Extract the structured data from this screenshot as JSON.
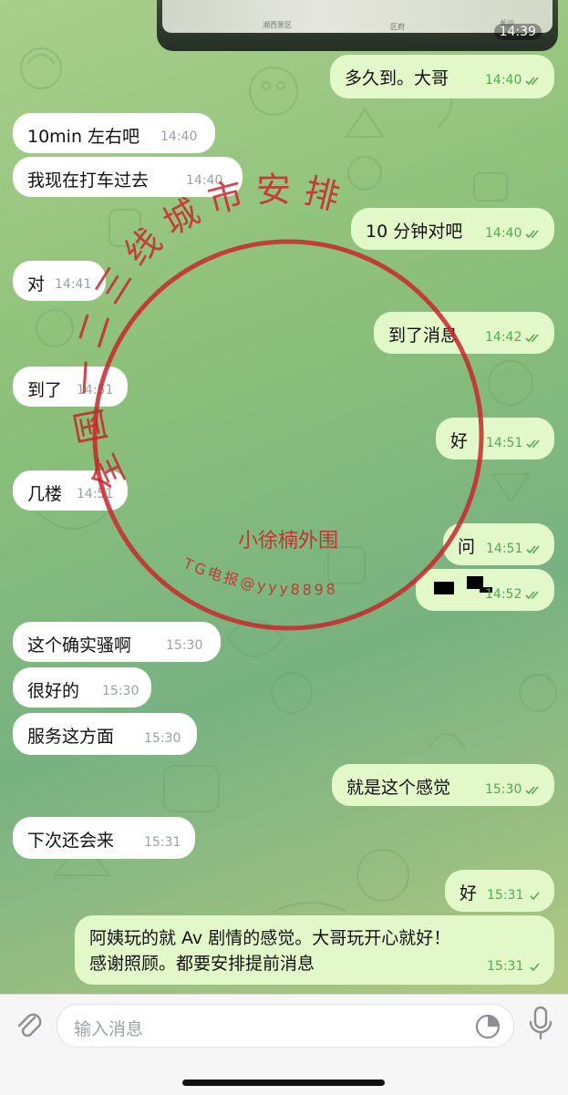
{
  "image_message": {
    "time": "14:39",
    "map_labels": [
      "湘西景区",
      "长沙",
      "区府"
    ]
  },
  "messages": [
    {
      "id": "m1",
      "dir": "out",
      "text": "多久到。大哥",
      "time": "14:40",
      "read": true
    },
    {
      "id": "m2",
      "dir": "in",
      "text": "10min 左右吧",
      "time": "14:40"
    },
    {
      "id": "m3",
      "dir": "in",
      "text": "我现在打车过去",
      "time": "14:40"
    },
    {
      "id": "m4",
      "dir": "out",
      "text": "10 分钟对吧",
      "time": "14:40",
      "read": true
    },
    {
      "id": "m5",
      "dir": "in",
      "text": "对",
      "time": "14:41"
    },
    {
      "id": "m6",
      "dir": "out",
      "text": "到了消息",
      "time": "14:42",
      "read": true
    },
    {
      "id": "m7",
      "dir": "in",
      "text": "到了",
      "time": "14:51"
    },
    {
      "id": "m8",
      "dir": "out",
      "text": "好",
      "time": "14:51",
      "read": true
    },
    {
      "id": "m9",
      "dir": "in",
      "text": "几楼",
      "time": "14:51"
    },
    {
      "id": "m10",
      "dir": "out",
      "text": "问",
      "time": "14:51",
      "read": true
    },
    {
      "id": "m11",
      "dir": "out",
      "text": "",
      "time": "14:52",
      "read": true,
      "redacted": true
    },
    {
      "id": "m12",
      "dir": "in",
      "text": "这个确实骚啊",
      "time": "15:30"
    },
    {
      "id": "m13",
      "dir": "in",
      "text": "很好的",
      "time": "15:30"
    },
    {
      "id": "m14",
      "dir": "in",
      "text": "服务这方面",
      "time": "15:30"
    },
    {
      "id": "m15",
      "dir": "out",
      "text": "就是这个感觉",
      "time": "15:30",
      "read": true
    },
    {
      "id": "m16",
      "dir": "in",
      "text": "下次还会来",
      "time": "15:31"
    },
    {
      "id": "m17",
      "dir": "out",
      "text": "好",
      "time": "15:31",
      "read": false
    },
    {
      "id": "m18",
      "dir": "out",
      "lines": [
        "阿姨玩的就 Av 剧情的感觉。大哥玩开心就好！",
        "感谢照顾。都要安排提前消息"
      ],
      "time": "15:31",
      "read": false
    }
  ],
  "stamp": {
    "ring_text": "全国一二三线城市安排",
    "center_text": "小徐楠外围",
    "bottom_text": "TG电报@yyy8898",
    "color": "#c8282c"
  },
  "input": {
    "placeholder": "输入消息"
  },
  "icons": [
    "attach-icon",
    "sticker-icon",
    "microphone-icon",
    "double-check-icon",
    "single-check-icon"
  ],
  "colors": {
    "outgoing_bubble": "#e3f8c8",
    "incoming_bubble": "#ffffff",
    "accent_green": "#54a955"
  }
}
